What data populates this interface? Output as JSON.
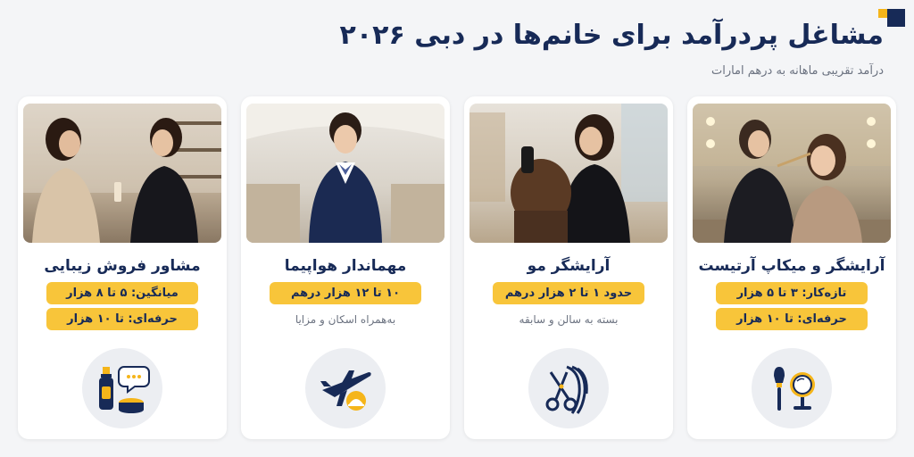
{
  "header": {
    "title": "مشاغل پردرآمد برای خانم‌ها در دبی ۲۰۲۶",
    "subtitle": "درآمد تقریبی ماهانه به درهم امارات"
  },
  "colors": {
    "navy": "#172a57",
    "yellow": "#f8c53a",
    "background": "#f4f5f7"
  },
  "cards": [
    {
      "title": "آرایشگر و میکاپ آرتیست",
      "pills": [
        "تازه‌کار: ۳ تا ۵ هزار",
        "حرفه‌ای: تا ۱۰ هزار"
      ],
      "note": "",
      "icon": "makeup-brush-mirror-icon"
    },
    {
      "title": "آرایشگر مو",
      "pills": [
        "حدود ۱ تا ۲ هزار درهم"
      ],
      "note": "بسته به سالن و سابقه",
      "icon": "scissors-hair-icon"
    },
    {
      "title": "مهماندار هواپیما",
      "pills": [
        "۱۰ تا ۱۲ هزار درهم"
      ],
      "note": "به‌همراه اسکان و مزایا",
      "icon": "airplane-cloche-icon"
    },
    {
      "title": "مشاور فروش زیبایی",
      "pills": [
        "میانگین: ۵ تا ۸ هزار",
        "حرفه‌ای: تا ۱۰ هزار"
      ],
      "note": "",
      "icon": "cosmetics-chat-icon"
    }
  ]
}
